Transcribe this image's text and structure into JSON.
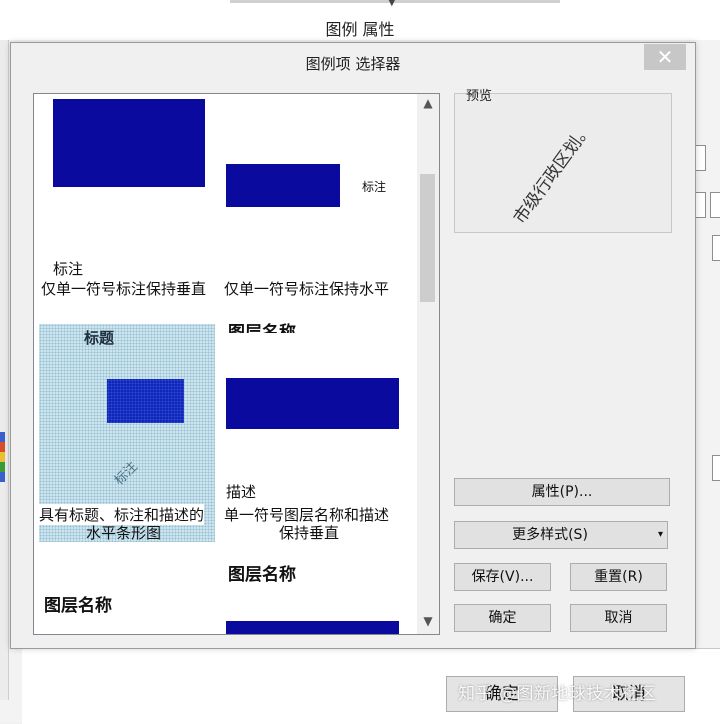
{
  "background_window": {
    "title": "图例 属性",
    "ok_label": "确定",
    "cancel_label": "取消",
    "watermark": "知乎 @图新地球技术社区"
  },
  "dialog": {
    "title": "图例项 选择器",
    "close_glyph": "✕"
  },
  "gallery": {
    "scroll_up_glyph": "▲",
    "scroll_down_glyph": "▼",
    "items": [
      {
        "annotation": "标注",
        "caption": "仅单一符号标注保持垂直"
      },
      {
        "annotation": "标注",
        "caption": "仅单一符号标注保持水平",
        "heading_cut": "图层名称"
      },
      {
        "title": "标题",
        "annotation": "标注",
        "caption_line1": "具有标题、标注和描述的",
        "caption_line2": "水平条形图"
      },
      {
        "description": "描述",
        "caption_line1": "单一符号图层名称和描述",
        "caption_line2": "保持垂直"
      },
      {
        "heading": "图层名称"
      },
      {
        "heading": "图层名称"
      }
    ]
  },
  "preview": {
    "label": "预览",
    "sample_text": "市级行政区划。"
  },
  "buttons": {
    "properties": "属性(P)...",
    "more_styles": "更多样式(S)",
    "more_styles_arrow": "▾",
    "save": "保存(V)...",
    "reset": "重置(R)",
    "ok": "确定",
    "cancel": "取消"
  },
  "colors": {
    "symbol_fill": "#0a0a9e",
    "selected_item_bg": "#cfe3ec"
  }
}
